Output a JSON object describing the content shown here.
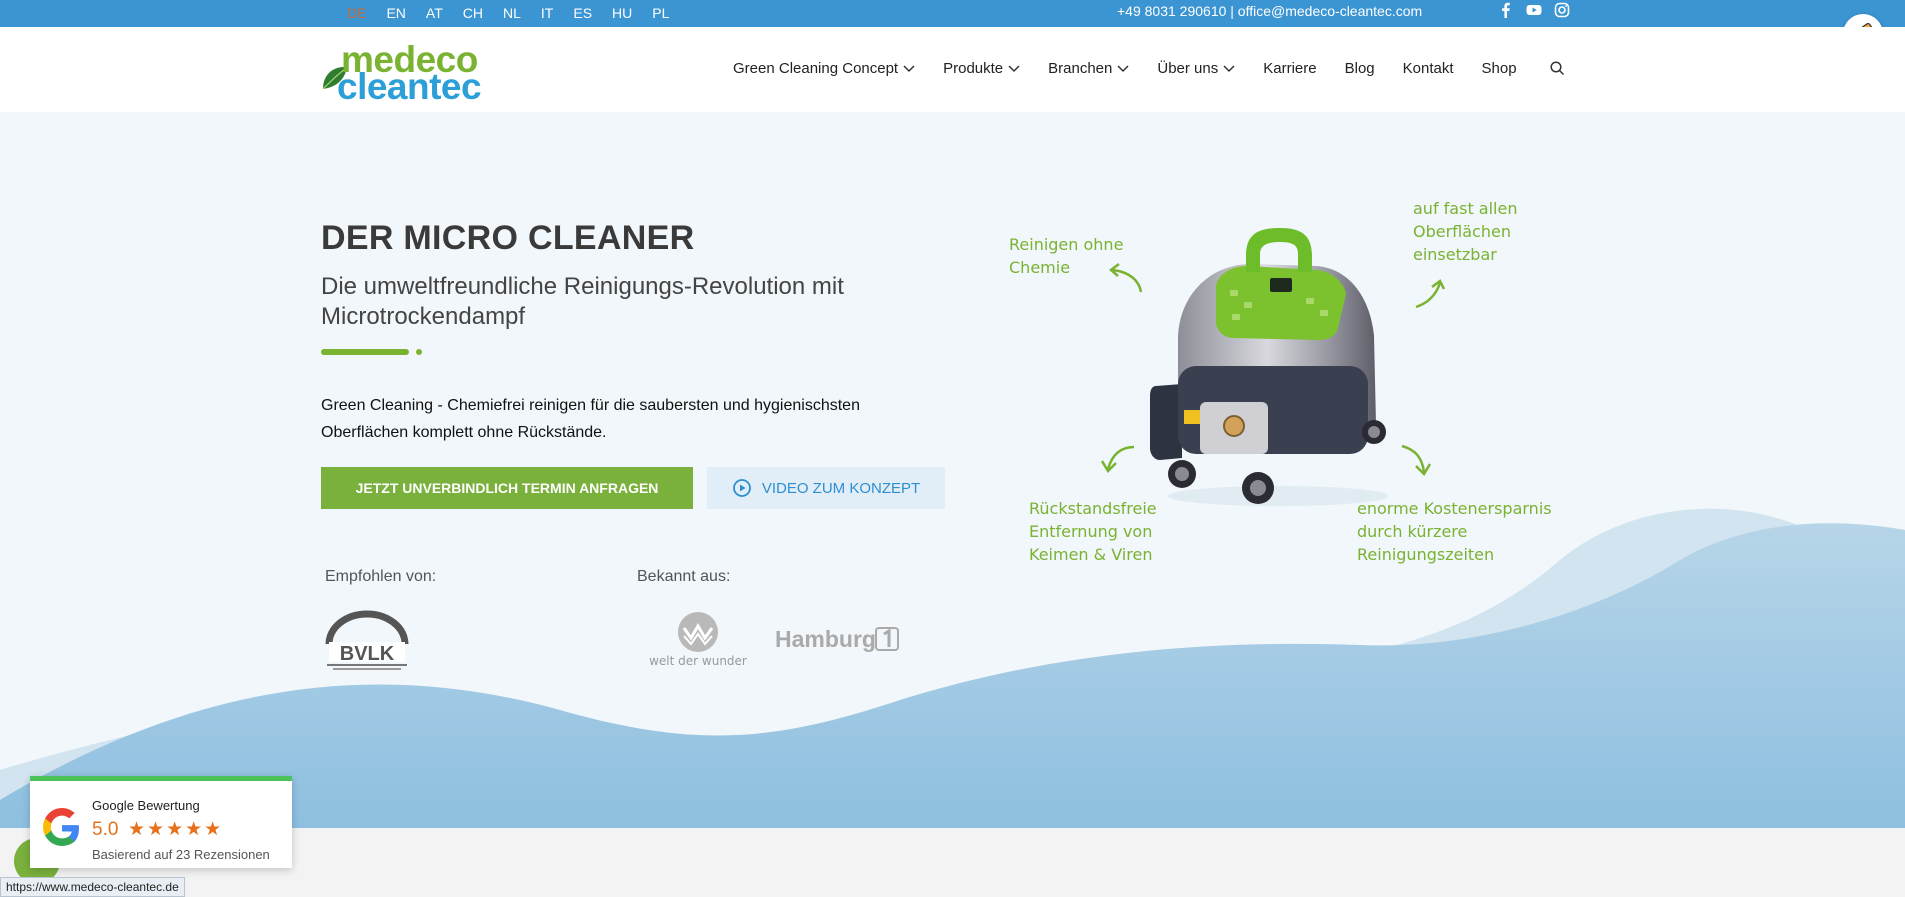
{
  "topbar": {
    "languages": [
      "DE",
      "EN",
      "AT",
      "CH",
      "NL",
      "IT",
      "ES",
      "HU",
      "PL"
    ],
    "active_language": "DE",
    "contact": "+49 8031 290610 | office@medeco-cleantec.com",
    "socials": [
      "facebook-icon",
      "youtube-icon",
      "instagram-icon"
    ]
  },
  "logo": {
    "line1": "medeco",
    "line2": "cleantec"
  },
  "nav": {
    "items": [
      {
        "label": "Green Cleaning Concept",
        "dropdown": true
      },
      {
        "label": "Produkte",
        "dropdown": true
      },
      {
        "label": "Branchen",
        "dropdown": true
      },
      {
        "label": "Über uns",
        "dropdown": true
      },
      {
        "label": "Karriere",
        "dropdown": false
      },
      {
        "label": "Blog",
        "dropdown": false
      },
      {
        "label": "Kontakt",
        "dropdown": false
      },
      {
        "label": "Shop",
        "dropdown": false
      }
    ]
  },
  "hero": {
    "title": "DER MICRO CLEANER",
    "subtitle": "Die umweltfreundliche Reinigungs-Revolution mit Microtrockendampf",
    "text": "Green Cleaning - Chemiefrei reinigen für die saubersten und hygienischsten Oberflächen komplett ohne Rückstände.",
    "primary_button": "JETZT UNVERBINDLICH TERMIN ANFRAGEN",
    "secondary_button": "VIDEO ZUM KONZEPT",
    "recommended_label": "Empfohlen von:",
    "known_label": "Bekannt aus:",
    "bvlk": "BVLK",
    "wdw": "welt der wunder",
    "hamburg": "Hamburg"
  },
  "annotations": {
    "a1": [
      "Reinigen ohne",
      "Chemie"
    ],
    "a2": [
      "auf fast allen",
      "Oberflächen",
      "einsetzbar"
    ],
    "a3": [
      "Rückstandsfreie",
      "Entfernung von",
      "Keimen & Viren"
    ],
    "a4": [
      "enorme Kostenersparnis",
      "durch kürzere",
      "Reinigungszeiten"
    ]
  },
  "google_review": {
    "title": "Google Bewertung",
    "score": "5.0",
    "stars": "★★★★★",
    "reviews": "Basierend auf 23 Rezensionen"
  },
  "status_url": "https://www.medeco-cleantec.de",
  "colors": {
    "topbar": "#3b95d3",
    "green": "#7ab231",
    "blue": "#2d9fd8"
  }
}
